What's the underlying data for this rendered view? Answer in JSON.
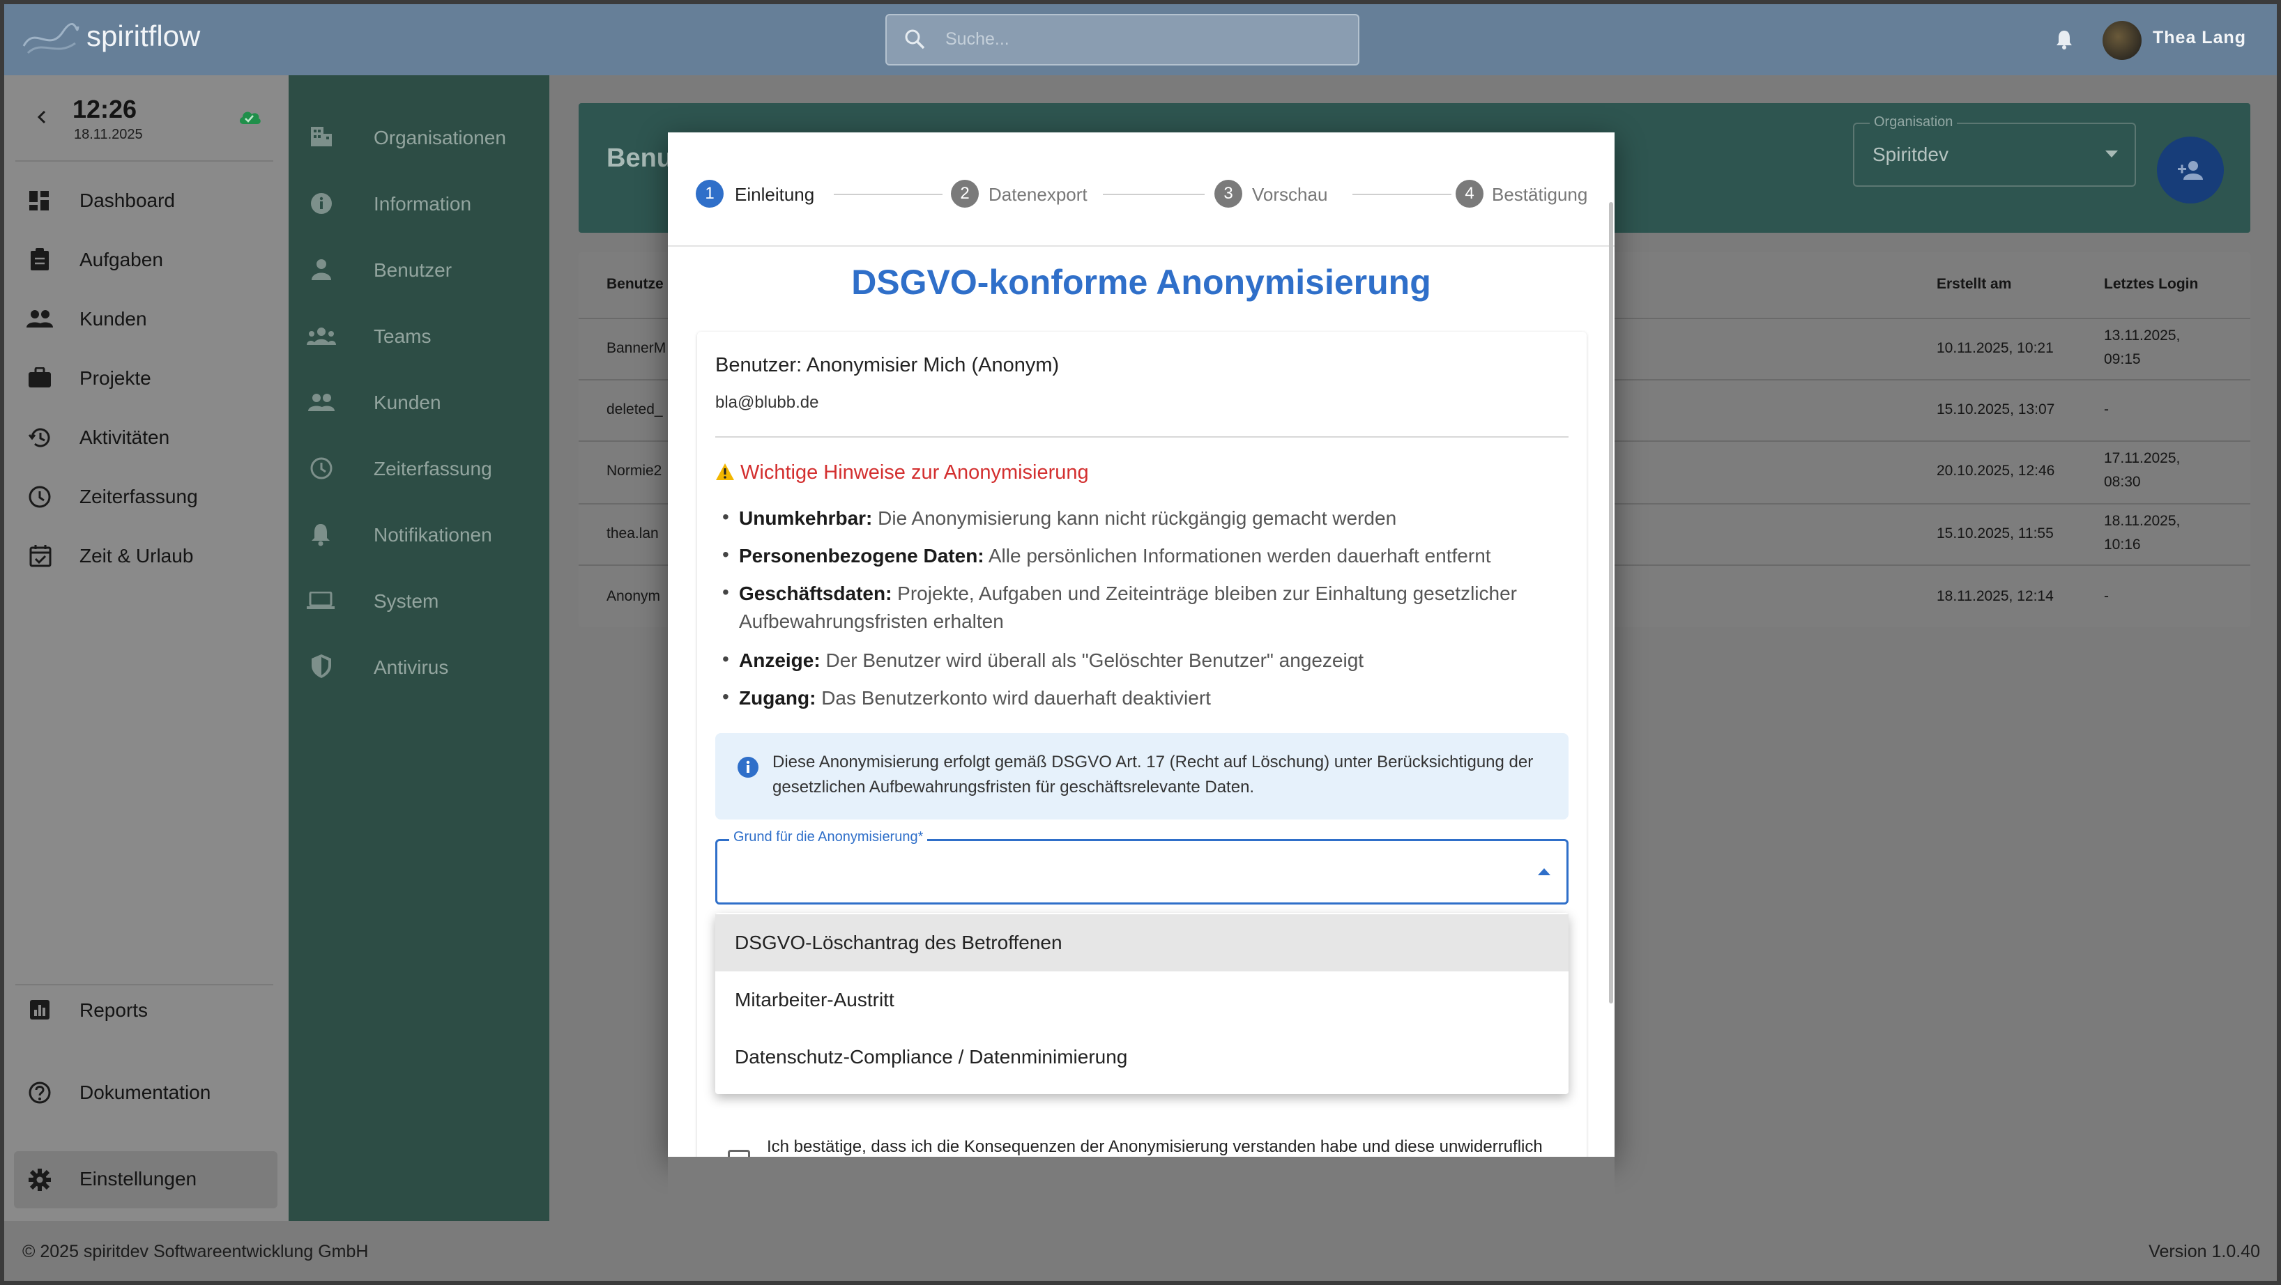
{
  "app": {
    "name": "spiritflow"
  },
  "search": {
    "placeholder": "Suche..."
  },
  "user": {
    "name": "Thea Lang"
  },
  "clock": {
    "time": "12:26",
    "date": "18.11.2025"
  },
  "sidebar": {
    "items": [
      {
        "label": "Dashboard",
        "icon": "dashboard-icon"
      },
      {
        "label": "Aufgaben",
        "icon": "clipboard-icon"
      },
      {
        "label": "Kunden",
        "icon": "people-icon"
      },
      {
        "label": "Projekte",
        "icon": "briefcase-icon"
      },
      {
        "label": "Aktivitäten",
        "icon": "history-icon"
      },
      {
        "label": "Zeiterfassung",
        "icon": "clock-icon"
      },
      {
        "label": "Zeit & Urlaub",
        "icon": "calendar-icon"
      }
    ],
    "bottom": [
      {
        "label": "Reports",
        "icon": "chart-icon"
      },
      {
        "label": "Dokumentation",
        "icon": "help-icon"
      },
      {
        "label": "Einstellungen",
        "icon": "gear-icon"
      }
    ]
  },
  "settings_nav": {
    "items": [
      {
        "label": "Organisationen",
        "icon": "building-icon"
      },
      {
        "label": "Information",
        "icon": "info-icon"
      },
      {
        "label": "Benutzer",
        "icon": "person-icon"
      },
      {
        "label": "Teams",
        "icon": "team-icon"
      },
      {
        "label": "Kunden",
        "icon": "people-icon"
      },
      {
        "label": "Zeiterfassung",
        "icon": "clock-icon"
      },
      {
        "label": "Notifikationen",
        "icon": "bell-icon"
      },
      {
        "label": "System",
        "icon": "laptop-icon"
      },
      {
        "label": "Antivirus",
        "icon": "shield-icon"
      }
    ]
  },
  "page": {
    "title_partial": "Benu"
  },
  "organisation": {
    "label": "Organisation",
    "value": "Spiritdev"
  },
  "table": {
    "headers": {
      "user": "Benutze",
      "created": "Erstellt am",
      "last_login": "Letztes Login"
    },
    "rows": [
      {
        "user": "BannerM",
        "created": "10.11.2025, 10:21",
        "login_line1": "13.11.2025,",
        "login_line2": "09:15"
      },
      {
        "user": "deleted_",
        "created": "15.10.2025, 13:07",
        "login_line1": "-",
        "login_line2": ""
      },
      {
        "user": "Normie2",
        "created": "20.10.2025, 12:46",
        "login_line1": "17.11.2025,",
        "login_line2": "08:30"
      },
      {
        "user": "thea.lan",
        "created": "15.10.2025, 11:55",
        "login_line1": "18.11.2025,",
        "login_line2": "10:16"
      },
      {
        "user": "Anonym",
        "created": "18.11.2025, 12:14",
        "login_line1": "-",
        "login_line2": ""
      }
    ]
  },
  "footer": {
    "copyright": "© 2025 spiritdev Softwareentwicklung GmbH",
    "version": "Version 1.0.40"
  },
  "modal": {
    "steps": [
      {
        "num": "1",
        "label": "Einleitung",
        "active": true
      },
      {
        "num": "2",
        "label": "Datenexport",
        "active": false
      },
      {
        "num": "3",
        "label": "Vorschau",
        "active": false
      },
      {
        "num": "4",
        "label": "Bestätigung",
        "active": false
      }
    ],
    "title": "DSGVO-konforme Anonymisierung",
    "user_line": "Benutzer: Anonymisier Mich (Anonym)",
    "email": "bla@blubb.de",
    "warning_title": "Wichtige Hinweise zur Anonymisierung",
    "bullets": [
      {
        "bold": "Unumkehrbar:",
        "text": " Die Anonymisierung kann nicht rückgängig gemacht werden"
      },
      {
        "bold": "Personenbezogene Daten:",
        "text": " Alle persönlichen Informationen werden dauerhaft entfernt"
      },
      {
        "bold": "Geschäftsdaten:",
        "text": " Projekte, Aufgaben und Zeiteinträge bleiben zur Einhaltung gesetzlicher Aufbewahrungsfristen erhalten"
      },
      {
        "bold": "Anzeige:",
        "text": " Der Benutzer wird überall als \"Gelöschter Benutzer\" angezeigt"
      },
      {
        "bold": "Zugang:",
        "text": " Das Benutzerkonto wird dauerhaft deaktiviert"
      }
    ],
    "info_text": "Diese Anonymisierung erfolgt gemäß DSGVO Art. 17 (Recht auf Löschung) unter Berücksichtigung der gesetzlichen Aufbewahrungsfristen für geschäftsrelevante Daten.",
    "reason_label": "Grund für die Anonymisierung*",
    "reason_value": "",
    "reason_options": [
      "DSGVO-Löschantrag des Betroffenen",
      "Mitarbeiter-Austritt",
      "Datenschutz-Compliance / Datenminimierung"
    ],
    "confirm_text": "Ich bestätige, dass ich die Konsequenzen der Anonymisierung verstanden habe und diese unwiderruflich"
  },
  "colors": {
    "topbar": "#667f98",
    "sidebar2": "#2d4d45",
    "accent": "#2f6fc9",
    "warning": "#d32f2f",
    "info_bg": "#e6f1fb"
  }
}
